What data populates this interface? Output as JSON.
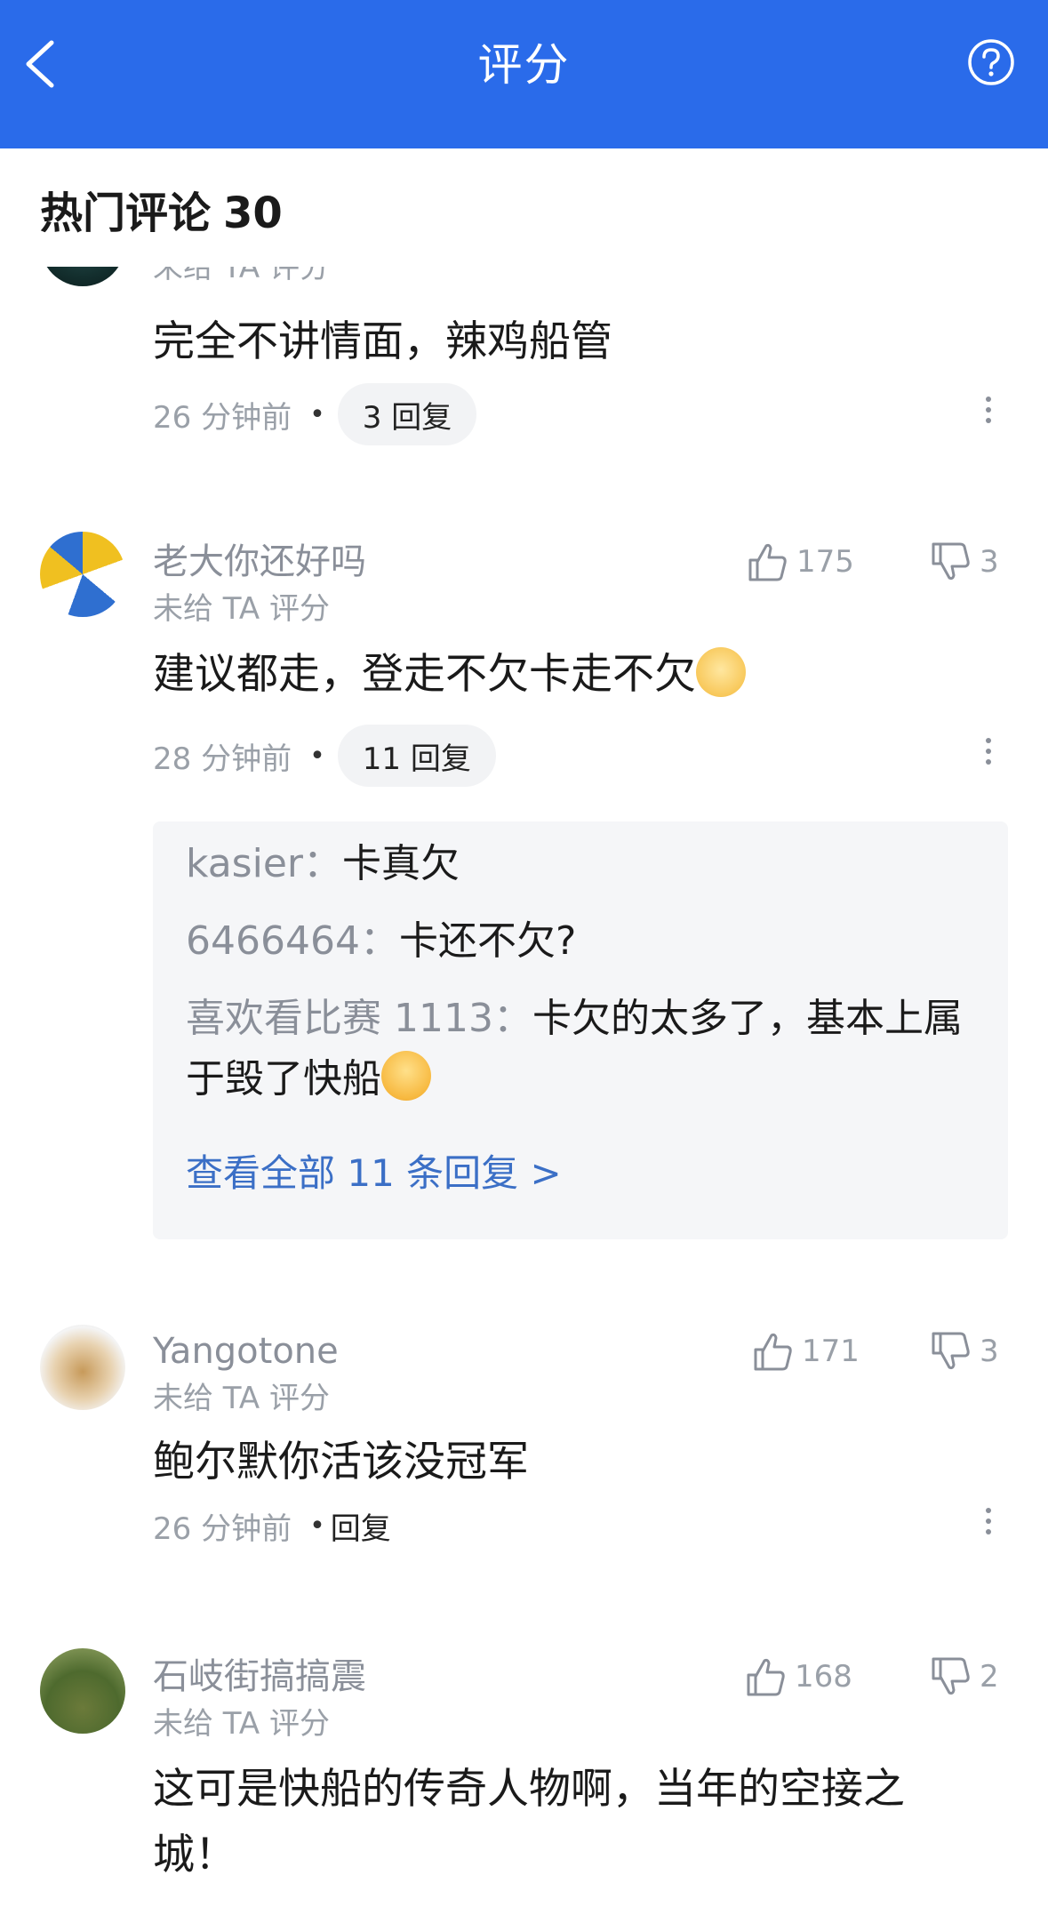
{
  "header": {
    "title": "评分",
    "bg_color": "#2a6bea"
  },
  "section": {
    "title": "热门评论",
    "count": "30"
  },
  "comments": [
    {
      "name": "",
      "rating": "未给 TA 评分",
      "text": "完全不讲情面，辣鸡船管",
      "time": "26 分钟前",
      "reply_label": "3 回复"
    },
    {
      "name": "老大你还好吗",
      "rating": "未给 TA 评分",
      "likes": "175",
      "dislikes": "3",
      "text": "建议都走，登走不欠卡走不欠",
      "time": "28 分钟前",
      "reply_label": "11 回复",
      "replies": [
        {
          "user": "kasier：",
          "text": "卡真欠"
        },
        {
          "user": "6466464：",
          "text": "卡还不欠?"
        },
        {
          "user": "喜欢看比赛 1113：",
          "text": "卡欠的太多了，基本上属于毁了快船"
        }
      ],
      "view_all": "查看全部 11 条回复 >"
    },
    {
      "name": "Yangotone",
      "rating": "未给 TA 评分",
      "likes": "171",
      "dislikes": "3",
      "text": "鲍尔默你活该没冠军",
      "time": "26 分钟前",
      "reply_label": "回复"
    },
    {
      "name": "石岐街搞搞震",
      "rating": "未给 TA 评分",
      "likes": "168",
      "dislikes": "2",
      "text": "这可是快船的传奇人物啊，当年的空接之城！"
    }
  ]
}
